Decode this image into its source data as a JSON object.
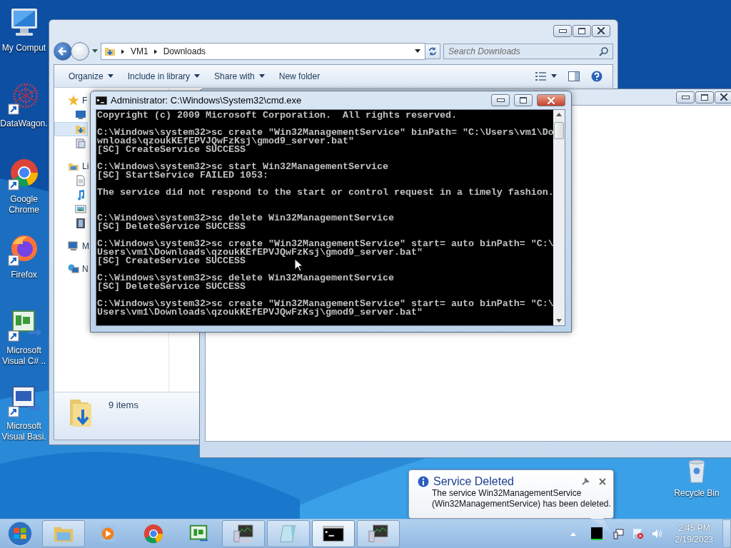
{
  "desktop_icons": [
    {
      "kind": "computer",
      "label": "My Comput"
    },
    {
      "kind": "datawagon",
      "label": "DataWagon.",
      "shortcut": true
    },
    {
      "kind": "chrome",
      "label": "Google Chrome",
      "shortcut": true
    },
    {
      "kind": "firefox",
      "label": "Firefox",
      "shortcut": true
    },
    {
      "kind": "csharp",
      "label": "Microsoft Visual C# ..",
      "shortcut": true
    },
    {
      "kind": "vb",
      "label": "Microsoft Visual Basi.",
      "shortcut": true
    }
  ],
  "explorer": {
    "breadcrumb": [
      "VM1",
      "Downloads"
    ],
    "search": {
      "placeholder": "Search Downloads"
    },
    "toolbar": [
      {
        "label": "Organize",
        "dropdown": true
      },
      {
        "label": "Include in library",
        "dropdown": true
      },
      {
        "label": "Share with",
        "dropdown": true
      },
      {
        "label": "New folder",
        "dropdown": false
      }
    ],
    "nav": [
      {
        "kind": "favorites",
        "label": "F",
        "selected": false
      },
      {
        "kind": "desktop",
        "selected": false
      },
      {
        "kind": "downloads",
        "selected": true
      },
      {
        "kind": "recent",
        "selected": false
      },
      {
        "kind": "libraries",
        "label": "Li",
        "selected": false
      },
      {
        "kind": "documents",
        "selected": false
      },
      {
        "kind": "music",
        "selected": false
      },
      {
        "kind": "pictures",
        "selected": false
      },
      {
        "kind": "videos",
        "selected": false
      },
      {
        "kind": "computer",
        "label": "M",
        "selected": false
      },
      {
        "kind": "network",
        "label": "N",
        "selected": false
      }
    ],
    "status": "9 items"
  },
  "console": {
    "title": "Administrator: C:\\Windows\\System32\\cmd.exe",
    "blocks": [
      {
        "kind": "normal",
        "lines": [
          "Copyright (c) 2009 Microsoft Corporation.  All rights reserved."
        ]
      },
      {
        "kind": "normal",
        "lines": [
          "C:\\Windows\\system32>sc create \"Win32ManagementService\" binPath= \"C:\\Users\\vm1\\Do",
          "wnloads\\qzoukKEfEPVJQwFzKsj\\gmod9_server.bat\"",
          "[SC] CreateService SUCCESS"
        ]
      },
      {
        "kind": "normal",
        "lines": [
          "C:\\Windows\\system32>sc start Win32ManagementService",
          "[SC] StartService FAILED 1053:"
        ]
      },
      {
        "kind": "normal",
        "lines": [
          "The service did not respond to the start or control request in a timely fashion."
        ]
      },
      {
        "kind": "after_pause",
        "lines": [
          "C:\\Windows\\system32>sc delete Win32ManagementService",
          "[SC] DeleteService SUCCESS"
        ]
      },
      {
        "kind": "normal",
        "lines": [
          "C:\\Windows\\system32>sc create \"Win32ManagementService\" start= auto binPath= \"C:\\",
          "Users\\vm1\\Downloads\\qzoukKEfEPVJQwFzKsj\\gmod9_server.bat\"",
          "[SC] CreateService SUCCESS"
        ]
      },
      {
        "kind": "normal",
        "lines": [
          "C:\\Windows\\system32>sc delete Win32ManagementService",
          "[SC] DeleteService SUCCESS"
        ]
      },
      {
        "kind": "normal",
        "lines": [
          "C:\\Windows\\system32>sc create \"Win32ManagementService\" start= auto binPath= \"C:\\",
          "Users\\vm1\\Downloads\\qzoukKEfEPVJQwFzKsj\\gmod9_server.bat\""
        ]
      }
    ]
  },
  "notification": {
    "title": "Service Deleted",
    "message": "The service Win32ManagementService (Win32ManagementService) has been deleted."
  },
  "recycle_bin": {
    "label": "Recycle Bin"
  },
  "taskbar": {
    "items": [
      {
        "kind": "explorer",
        "running": true,
        "selected": false
      },
      {
        "kind": "media",
        "running": false,
        "selected": false
      },
      {
        "kind": "chrome",
        "running": false,
        "selected": false
      },
      {
        "kind": "csharp",
        "running": false,
        "selected": false
      },
      {
        "kind": "vm",
        "running": true,
        "selected": false
      },
      {
        "kind": "notepad",
        "running": true,
        "selected": false
      },
      {
        "kind": "console",
        "running": true,
        "selected": true
      },
      {
        "kind": "vm",
        "running": true,
        "selected": false
      }
    ],
    "clock": {
      "time": "2:45 PM",
      "date": "2/19/2023"
    }
  }
}
